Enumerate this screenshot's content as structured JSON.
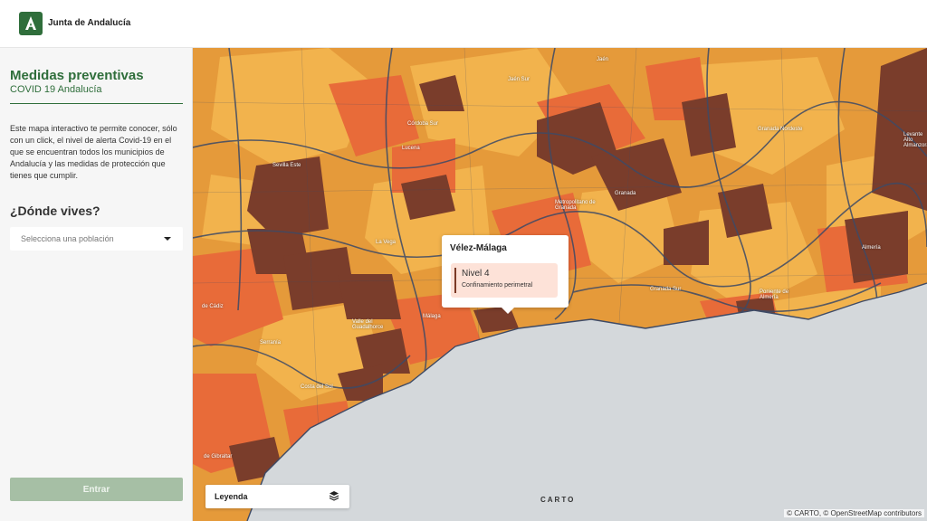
{
  "header": {
    "brand": "Junta de Andalucía"
  },
  "sidebar": {
    "title": "Medidas preventivas",
    "subtitle": "COVID 19 Andalucía",
    "description": "Este mapa interactivo te permite conocer, sólo con un click, el nivel de alerta Covid-19 en el que se encuentran todos los municipios de Andalucía y las medidas de protección que tienes que cumplir.",
    "question": "¿Dónde vives?",
    "select_placeholder": "Selecciona una población",
    "enter_label": "Entrar"
  },
  "popup": {
    "title": "Vélez-Málaga",
    "level": "Nivel 4",
    "level_description": "Confinamiento perimetral"
  },
  "legend": {
    "label": "Leyenda"
  },
  "map": {
    "carto_label": "CARTO",
    "attribution": {
      "prefix": "© CARTO, ©",
      "osm": "OpenStreetMap",
      "suffix": "contributors"
    },
    "labels": [
      "Jaén",
      "Jaén Sur",
      "Córdoba Sur",
      "Granada Nordeste",
      "Levante Alto Almanzora",
      "Sevilla Este",
      "Lucena",
      "Metropolitano de Granada",
      "Granada",
      "La Vega",
      "Almería",
      "Granada Sur",
      "Poniente de Almería",
      "de Cádiz",
      "Málaga",
      "Valle del Guadalhorce",
      "Serranía",
      "Costa del Sol",
      "de Gibraltar"
    ],
    "colors": {
      "level_1": "#f2b34d",
      "level_2": "#e59a3a",
      "level_3": "#e86b39",
      "level_4": "#7a3d2b",
      "sea": "#d4d8db",
      "borders": "#3d4a66"
    }
  },
  "colors": {
    "brand_green": "#2f6e3b",
    "enter_disabled": "#a6bfa5"
  }
}
